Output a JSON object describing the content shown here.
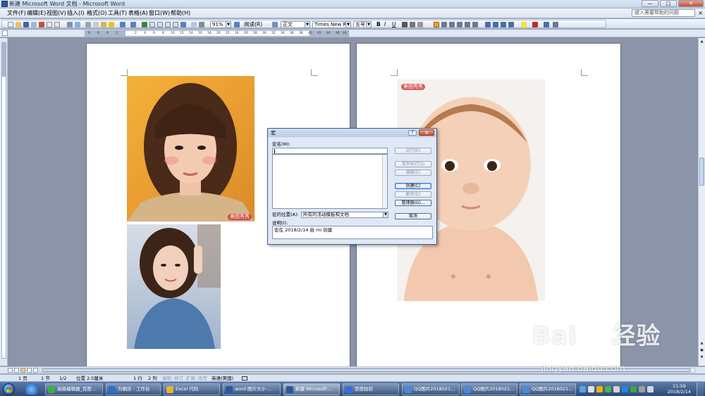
{
  "window": {
    "title": "新建 Microsoft Word 文档 - Microsoft Word",
    "controls": [
      "—",
      "□",
      "✕"
    ]
  },
  "menubar": {
    "items": [
      "文件(F)",
      "编辑(E)",
      "视图(V)",
      "插入(I)",
      "格式(O)",
      "工具(T)",
      "表格(A)",
      "窗口(W)",
      "帮助(H)"
    ],
    "help_placeholder": "键入需要帮助的问题",
    "close": "×"
  },
  "toolbar": {
    "zoom": "91%",
    "read_label": "阅读(R)",
    "style": "正文",
    "font": "Times New Roman",
    "size": "五号",
    "bold": "B",
    "italic": "I",
    "underline": "U"
  },
  "ruler": {
    "ticks": [
      "8",
      "6",
      "4",
      "2",
      "2",
      "4",
      "6",
      "8",
      "10",
      "12",
      "14",
      "16",
      "18",
      "20",
      "22",
      "24",
      "26",
      "28",
      "30",
      "32",
      "34",
      "36",
      "38",
      "40",
      "42",
      "44",
      "46",
      "48"
    ]
  },
  "page_images": {
    "photo_watermark": "美图秀秀"
  },
  "macro_dialog": {
    "title": "宏",
    "help_btn": "?",
    "close_btn": "✕",
    "name_label": "宏名(M):",
    "name_value": "",
    "buttons": {
      "run": "运行(R)",
      "step": "单步执行(S)",
      "edit": "编辑(E)",
      "create": "创建(C)",
      "delete": "删除(D)",
      "organizer": "管理器(G)...",
      "cancel": "取消"
    },
    "location_label": "宏的位置(A):",
    "location_value": "所有的活动模板和文档",
    "description_label": "说明(I):",
    "description_value": "宏在 2018/2/14 由 mi 创建"
  },
  "statusbar": {
    "page": "1 页",
    "section": "1 节",
    "page_of": "1/2",
    "position": "位置 2.5厘米",
    "line": "1 行",
    "column": "2 列",
    "rec": "录制",
    "trk": "修订",
    "ext": "扩展",
    "ovr": "改写",
    "language": "英语(美国)"
  },
  "taskbar": {
    "tasks": [
      {
        "label": "高级编辑器_百度...",
        "color": "#3fae3a"
      },
      {
        "label": "为朝店 - 工作台",
        "color": "#2d6fd1"
      },
      {
        "label": "Excel 代码",
        "color": "#e3b43a"
      },
      {
        "label": "word 图片大小 -...",
        "color": "#2b579a"
      },
      {
        "label": "新建 Microsoft ...",
        "color": "#2b579a"
      },
      {
        "label": "百度经验",
        "color": "#3a6fd8"
      },
      {
        "label": "QQ图片2018021...",
        "color": "#4a8ad6"
      },
      {
        "label": "QQ图片2018021...",
        "color": "#4a8ad6"
      },
      {
        "label": "QQ图片2018021...",
        "color": "#4a8ad6"
      }
    ],
    "time": "11:59",
    "date": "2018/2/14"
  },
  "watermark": {
    "brand": "Bai",
    "brand_tail": "经验",
    "url": "jingyan.baidu.com"
  },
  "colors": {
    "word_blue": "#2b579a",
    "dialog_bg": "#dfe8f4",
    "page_bg": "#ffffff",
    "workspace": "#8b94a8"
  }
}
